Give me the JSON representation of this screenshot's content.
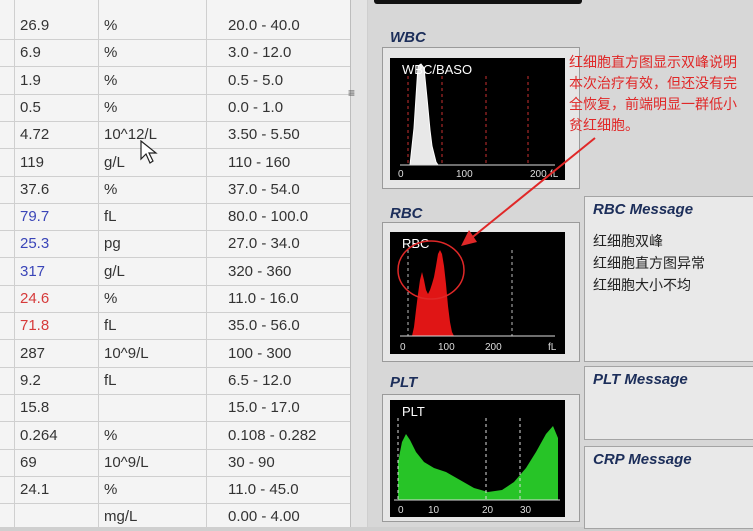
{
  "table": {
    "rows": [
      {
        "value": "26.9",
        "unit": "%",
        "range": "20.0 - 40.0",
        "style": "normal"
      },
      {
        "value": "6.9",
        "unit": "%",
        "range": "3.0 - 12.0",
        "style": "normal"
      },
      {
        "value": "1.9",
        "unit": "%",
        "range": "0.5 - 5.0",
        "style": "normal"
      },
      {
        "value": "0.5",
        "unit": "%",
        "range": "0.0 - 1.0",
        "style": "normal"
      },
      {
        "value": "4.72",
        "unit": "10^12/L",
        "range": "3.50 - 5.50",
        "style": "normal"
      },
      {
        "value": "119",
        "unit": "g/L",
        "range": "110 - 160",
        "style": "normal"
      },
      {
        "value": "37.6",
        "unit": "%",
        "range": "37.0 - 54.0",
        "style": "normal"
      },
      {
        "value": "79.7",
        "unit": "fL",
        "range": "80.0 - 100.0",
        "style": "blue"
      },
      {
        "value": "25.3",
        "unit": "pg",
        "range": "27.0 - 34.0",
        "style": "blue"
      },
      {
        "value": "317",
        "unit": "g/L",
        "range": "320 - 360",
        "style": "blue"
      },
      {
        "value": "24.6",
        "unit": "%",
        "range": "11.0 - 16.0",
        "style": "red"
      },
      {
        "value": "71.8",
        "unit": "fL",
        "range": "35.0 - 56.0",
        "style": "red"
      },
      {
        "value": "287",
        "unit": "10^9/L",
        "range": "100 - 300",
        "style": "normal"
      },
      {
        "value": "9.2",
        "unit": "fL",
        "range": "6.5 - 12.0",
        "style": "normal"
      },
      {
        "value": "15.8",
        "unit": "",
        "range": "15.0 - 17.0",
        "style": "normal"
      },
      {
        "value": "0.264",
        "unit": "%",
        "range": "0.108 - 0.282",
        "style": "normal"
      },
      {
        "value": "69",
        "unit": "10^9/L",
        "range": "30 - 90",
        "style": "normal"
      },
      {
        "value": "24.1",
        "unit": "%",
        "range": "11.0 - 45.0",
        "style": "normal"
      },
      {
        "value": "",
        "unit": "mg/L",
        "range": "0.00 - 4.00",
        "style": "normal"
      }
    ]
  },
  "wbc": {
    "section_title": "WBC",
    "hist_label": "WBC/BASO",
    "ticks": [
      "0",
      "100",
      "200"
    ],
    "unit": "fL"
  },
  "rbc": {
    "section_title": "RBC",
    "hist_label": "RBC",
    "ticks": [
      "0",
      "100",
      "200"
    ],
    "unit": "fL"
  },
  "plt": {
    "section_title": "PLT",
    "hist_label": "PLT",
    "ticks": [
      "0",
      "10",
      "20",
      "30"
    ],
    "unit": "fL"
  },
  "rbc_message": {
    "title": "RBC Message",
    "lines": [
      "红细胞双峰",
      "红细胞直方图异常",
      "红细胞大小不均"
    ]
  },
  "plt_message": {
    "title": "PLT Message"
  },
  "crp_message": {
    "title": "CRP Message"
  },
  "annotation": {
    "text": "红细胞直方图显示双峰说明本次治疗有效，但还没有完全恢复，前端明显一群低小贫红细胞。"
  },
  "colors": {
    "rbc_fill": "#e01515",
    "plt_fill": "#27c427",
    "wbc_fill": "#e8e8e8",
    "annotation": "#e02828",
    "marker": "#c83030"
  }
}
